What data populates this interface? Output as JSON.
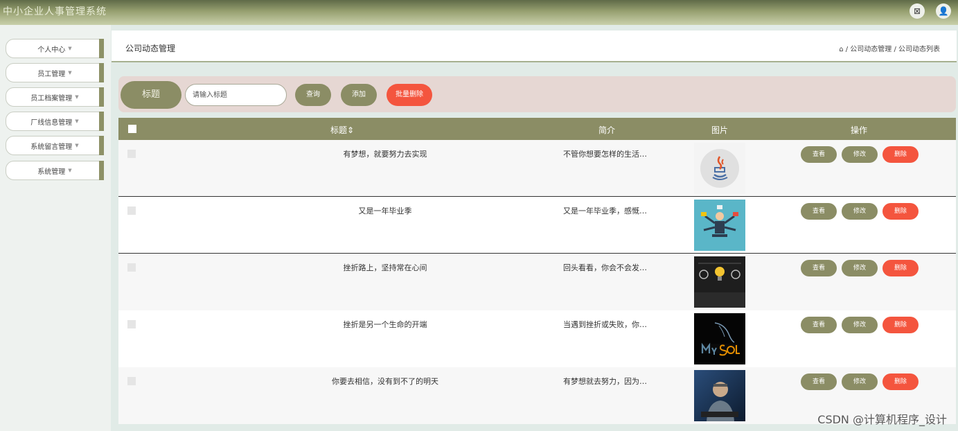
{
  "app": {
    "title": "中小企业人事管理系统",
    "close_icon_glyph": "⊠",
    "user_icon_glyph": "👤"
  },
  "sidebar": {
    "items": [
      {
        "label": "个人中心"
      },
      {
        "label": "员工管理"
      },
      {
        "label": "员工档案管理"
      },
      {
        "label": "厂线信息管理"
      },
      {
        "label": "系统留言管理"
      },
      {
        "label": "系统管理"
      }
    ]
  },
  "header": {
    "title": "公司动态管理",
    "breadcrumb": "⌂ / 公司动态管理 / 公司动态列表"
  },
  "search": {
    "label": "标题",
    "placeholder": "请输入标题",
    "query_label": "查询",
    "add_label": "添加",
    "batch_delete_label": "批量删除"
  },
  "table": {
    "columns": {
      "title": "标题⇕",
      "intro": "简介",
      "image": "图片",
      "actions": "操作"
    },
    "rows": [
      {
        "title": "有梦想，就要努力去实现",
        "intro": "不管你想要怎样的生活…",
        "image_icon": "java-logo-icon"
      },
      {
        "title": "又是一年毕业季",
        "intro": "又是一年毕业季，感慨…",
        "image_icon": "multitask-figure-icon"
      },
      {
        "title": "挫折路上，坚持常在心间",
        "intro": "回头看看，你会不会发…",
        "image_icon": "education-bulb-icon"
      },
      {
        "title": "挫折是另一个生命的开端",
        "intro": "当遇到挫折或失败，你…",
        "image_icon": "mysql-logo-icon"
      },
      {
        "title": "你要去相信，没有到不了的明天",
        "intro": "有梦想就去努力，因为…",
        "image_icon": "man-at-computer-icon"
      }
    ],
    "action_labels": {
      "view": "查看",
      "edit": "修改",
      "delete": "删除"
    }
  },
  "watermark": "CSDN @计算机程序_设计",
  "colors": {
    "olive": "#8b8d65",
    "red": "#f4553e",
    "search_bg": "#e6d7d3"
  }
}
